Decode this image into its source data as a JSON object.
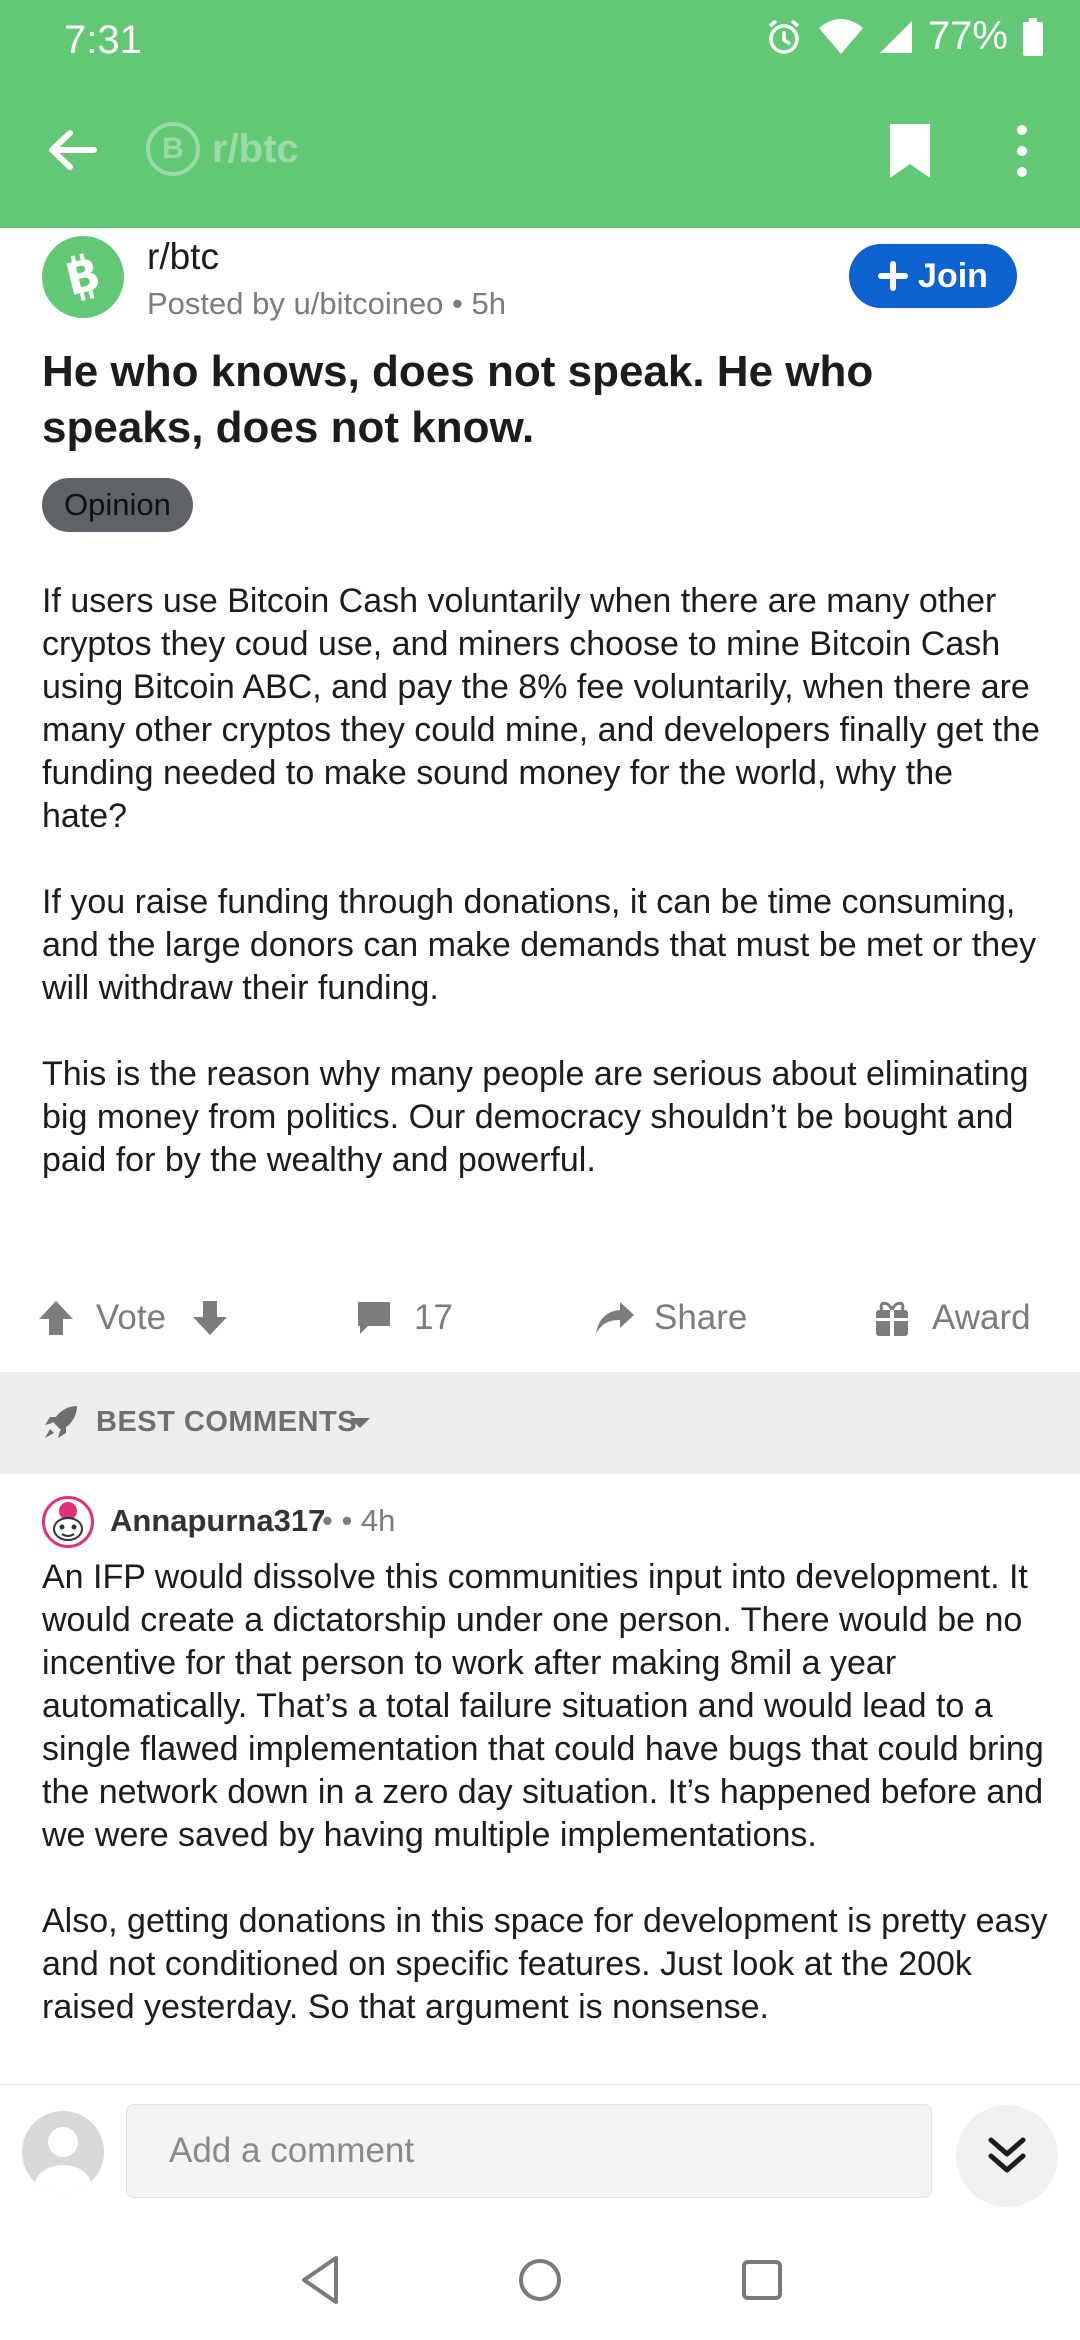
{
  "status_bar": {
    "time": "7:31",
    "battery": "77%"
  },
  "app_bar": {
    "subreddit": "r/btc",
    "logo_letter": "B"
  },
  "post": {
    "subreddit": "r/btc",
    "posted_by": "Posted by u/bitcoineo • 5h",
    "join_label": "Join",
    "title": "He who knows, does not speak. He who speaks, does not know.",
    "flair": "Opinion",
    "paragraphs": [
      "If users use Bitcoin Cash voluntarily when there are many other cryptos they coud use, and miners choose to mine Bitcoin Cash using Bitcoin ABC, and pay the 8% fee voluntarily, when there are many other cryptos they could mine, and developers finally get the funding needed to make sound money for the world, why the hate?",
      "If you raise funding through donations, it can be time consuming, and the large donors can make demands that must be met or they will withdraw their funding.",
      "This is the reason why many people are serious about eliminating big money from politics. Our democracy shouldn’t be bought and paid for by the wealthy and powerful."
    ],
    "actions": {
      "vote": "Vote",
      "comments": "17",
      "share": "Share",
      "award": "Award"
    }
  },
  "comments_sort": {
    "label": "BEST COMMENTS"
  },
  "comment": {
    "author": "Annapurna317",
    "meta": "• • 4h",
    "paragraphs": [
      "An IFP would dissolve this communities input into development. It would create a dictatorship under one person. There would be no incentive for that person to work after making 8mil a year automatically. That’s a total failure situation and would lead to a single flawed implementation that could have bugs that could bring the network down in a zero day situation. It’s happened before and we were saved by having multiple implementations.",
      "Also, getting donations in this space for development is pretty easy and not conditioned on specific features. Just look at the 200k raised yesterday. So that argument is nonsense."
    ]
  },
  "compose": {
    "placeholder": "Add a comment"
  },
  "colors": {
    "header": "#63c876",
    "join": "#0d62cf",
    "flair": "#5f6266",
    "sortbar": "#ededee"
  }
}
